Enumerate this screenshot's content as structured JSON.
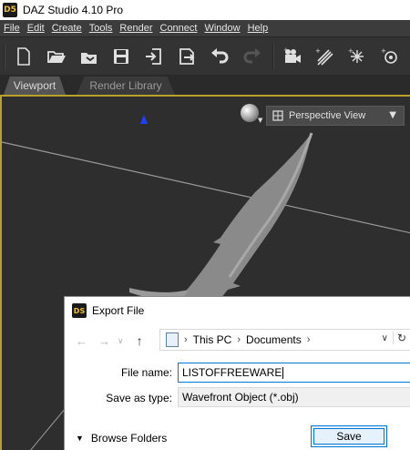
{
  "window": {
    "app_icon_text": "D5",
    "title": "DAZ Studio 4.10 Pro"
  },
  "menu": [
    "File",
    "Edit",
    "Create",
    "Tools",
    "Render",
    "Connect",
    "Window",
    "Help"
  ],
  "toolbar": {
    "icons": [
      "new-file-icon",
      "open-file-icon",
      "merge-file-icon",
      "save-icon",
      "import-icon",
      "export-icon",
      "undo-icon",
      "redo-icon",
      "add-camera-icon",
      "add-distant-light-icon",
      "add-spot-light-icon",
      "add-point-light-icon"
    ]
  },
  "tabs": {
    "viewport": "Viewport",
    "render_library": "Render Library"
  },
  "viewport": {
    "view_label": "Perspective View",
    "border_color": "#b8a12c"
  },
  "dialog": {
    "icon_text": "DS",
    "title": "Export File",
    "breadcrumbs": [
      "This PC",
      "Documents"
    ],
    "file_name_label": "File name:",
    "file_name_value": "LISTOFFREEWARE",
    "save_type_label": "Save as type:",
    "save_type_value": "Wavefront Object (*.obj)",
    "browse_folders": "Browse Folders",
    "save_button": "Save"
  }
}
